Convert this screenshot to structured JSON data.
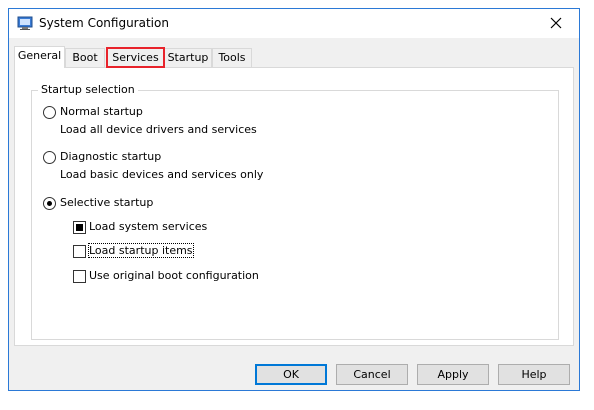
{
  "window": {
    "title": "System Configuration"
  },
  "tabs": [
    {
      "label": "General"
    },
    {
      "label": "Boot"
    },
    {
      "label": "Services"
    },
    {
      "label": "Startup"
    },
    {
      "label": "Tools"
    }
  ],
  "startup_selection": {
    "group_title": "Startup selection",
    "normal": {
      "label": "Normal startup",
      "description": "Load all device drivers and services",
      "selected": false
    },
    "diagnostic": {
      "label": "Diagnostic startup",
      "description": "Load basic devices and services only",
      "selected": false
    },
    "selective": {
      "label": "Selective startup",
      "selected": true
    },
    "options": [
      {
        "label": "Load system services",
        "checked": "indeterminate"
      },
      {
        "label": "Load startup items",
        "checked": false
      },
      {
        "label": "Use original boot configuration",
        "checked": false
      }
    ]
  },
  "buttons": {
    "ok": "OK",
    "cancel": "Cancel",
    "apply": "Apply",
    "help": "Help"
  },
  "colors": {
    "accent": "#0078d7",
    "highlight_box": "#e8232b",
    "window_border": "#2b79d6"
  }
}
